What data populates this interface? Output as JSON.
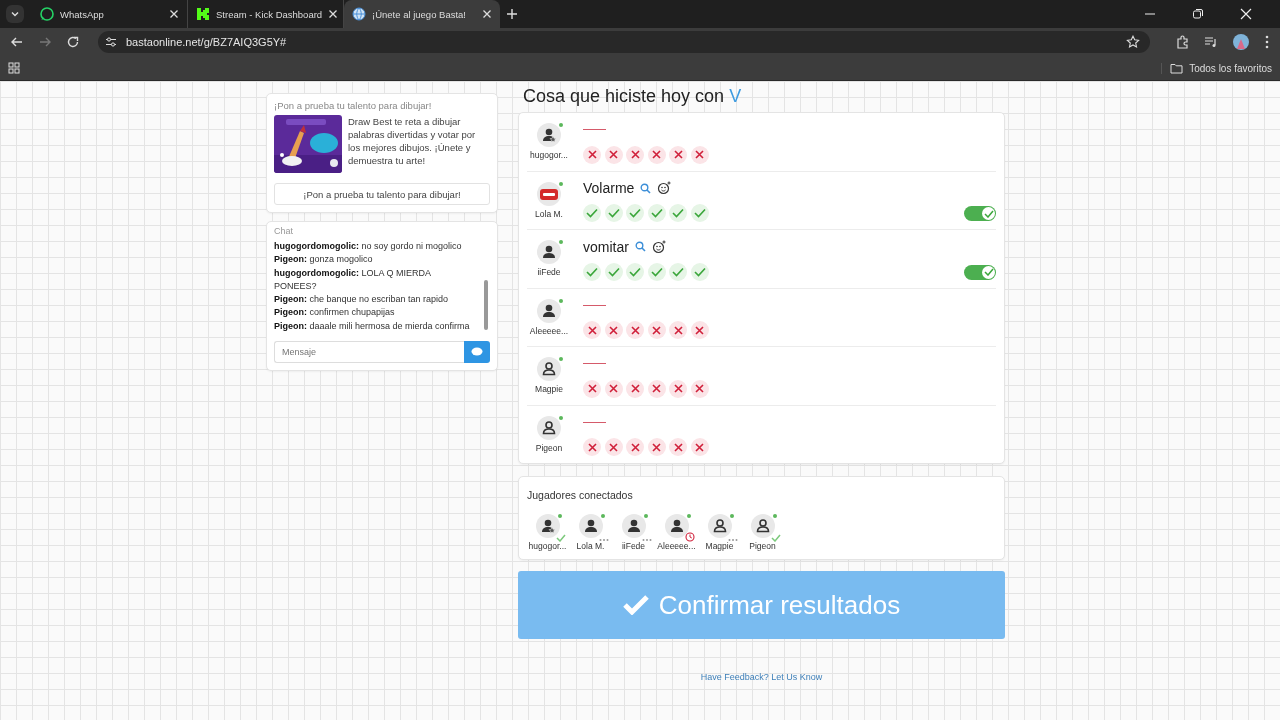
{
  "browser": {
    "tabs": [
      {
        "title": "WhatsApp",
        "kind": "whatsapp",
        "selected": false
      },
      {
        "title": "Stream - Kick Dashboard",
        "kind": "kick",
        "selected": false
      },
      {
        "title": "¡Únete al juego Basta!",
        "kind": "globe",
        "selected": true
      }
    ],
    "url": "bastaonline.net/g/BZ7AIQ3G5Y#",
    "bookmarks": "Todos los favoritos"
  },
  "promo": {
    "heading": "¡Pon a prueba tu talento para dibujar!",
    "text": "Draw Best te reta a dibujar palabras divertidas y votar por los mejores dibujos. ¡Únete y demuestra tu arte!",
    "button": "¡Pon a prueba tu talento para dibujar!"
  },
  "chat": {
    "title": "Chat",
    "placeholder": "Mensaje",
    "messages": [
      {
        "user": "hugogordomogolic:",
        "text": "no soy gordo ni mogolico"
      },
      {
        "user": "Pigeon:",
        "text": "gonza mogolico"
      },
      {
        "user": "hugogordomogolic:",
        "text": "LOLA Q MIERDA PONEES?"
      },
      {
        "user": "Pigeon:",
        "text": "che banque no escriban tan rapido"
      },
      {
        "user": "Pigeon:",
        "text": "confirmen chupapijas"
      },
      {
        "user": "Pigeon:",
        "text": "daaale mili hermosa de mierda confirma"
      }
    ]
  },
  "category": {
    "prefix": "Cosa que hiciste hoy con",
    "letter": "V"
  },
  "answers": [
    {
      "player": "hugogor...",
      "kind": "admin",
      "votes": [
        false,
        false,
        false,
        false,
        false,
        false
      ]
    },
    {
      "player": "Lola M.",
      "kind": "stop",
      "answer": "Volarme",
      "valid": true,
      "votes": [
        true,
        true,
        true,
        true,
        true,
        true
      ]
    },
    {
      "player": "iiFede",
      "kind": "solid",
      "answer": "vomitar",
      "valid": true,
      "votes": [
        true,
        true,
        true,
        true,
        true,
        true
      ]
    },
    {
      "player": "Aleeeee...",
      "kind": "solid",
      "votes": [
        false,
        false,
        false,
        false,
        false,
        false
      ]
    },
    {
      "player": "Magpie",
      "kind": "outline",
      "votes": [
        false,
        false,
        false,
        false,
        false,
        false
      ]
    },
    {
      "player": "Pigeon",
      "kind": "outline",
      "votes": [
        false,
        false,
        false,
        false,
        false,
        false
      ]
    }
  ],
  "connected": {
    "title": "Jugadores conectados",
    "players": [
      {
        "name": "hugogor...",
        "kind": "admin",
        "ready": true,
        "typing": false,
        "timed_out": false
      },
      {
        "name": "Lola M.",
        "kind": "solid",
        "ready": false,
        "typing": true,
        "timed_out": false
      },
      {
        "name": "iiFede",
        "kind": "solid",
        "ready": false,
        "typing": true,
        "timed_out": false
      },
      {
        "name": "Aleeeee...",
        "kind": "solid",
        "ready": false,
        "typing": false,
        "timed_out": true
      },
      {
        "name": "Magpie",
        "kind": "outline",
        "ready": false,
        "typing": true,
        "timed_out": false
      },
      {
        "name": "Pigeon",
        "kind": "outline",
        "ready": true,
        "typing": false,
        "timed_out": false
      }
    ]
  },
  "confirm_button": "Confirmar resultados",
  "feedback_link": "Have Feedback? Let Us Know"
}
